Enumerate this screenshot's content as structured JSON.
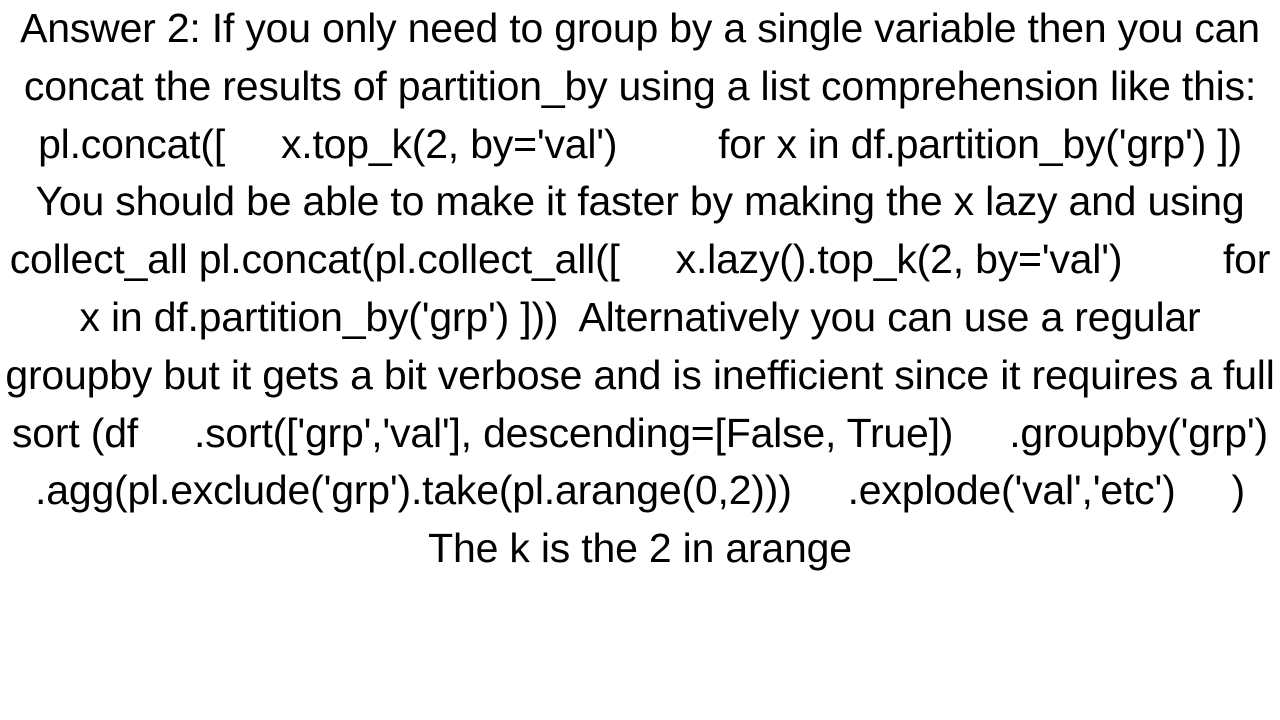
{
  "document": {
    "text": "Answer 2: If you only need to group by a single variable then you can concat the results of partition_by using a list comprehension like this: pl.concat([     x.top_k(2, by='val')         for x in df.partition_by('grp') ])  You should be able to make it faster by making the x lazy and using collect_all pl.concat(pl.collect_all([     x.lazy().top_k(2, by='val')         for x in df.partition_by('grp') ]))  Alternatively you can use a regular groupby but it gets a bit verbose and is inefficient since it requires a full sort (df     .sort(['grp','val'], descending=[False, True])     .groupby('grp')     .agg(pl.exclude('grp').take(pl.arange(0,2)))     .explode('val','etc')     )  The k is the 2 in arange"
  }
}
